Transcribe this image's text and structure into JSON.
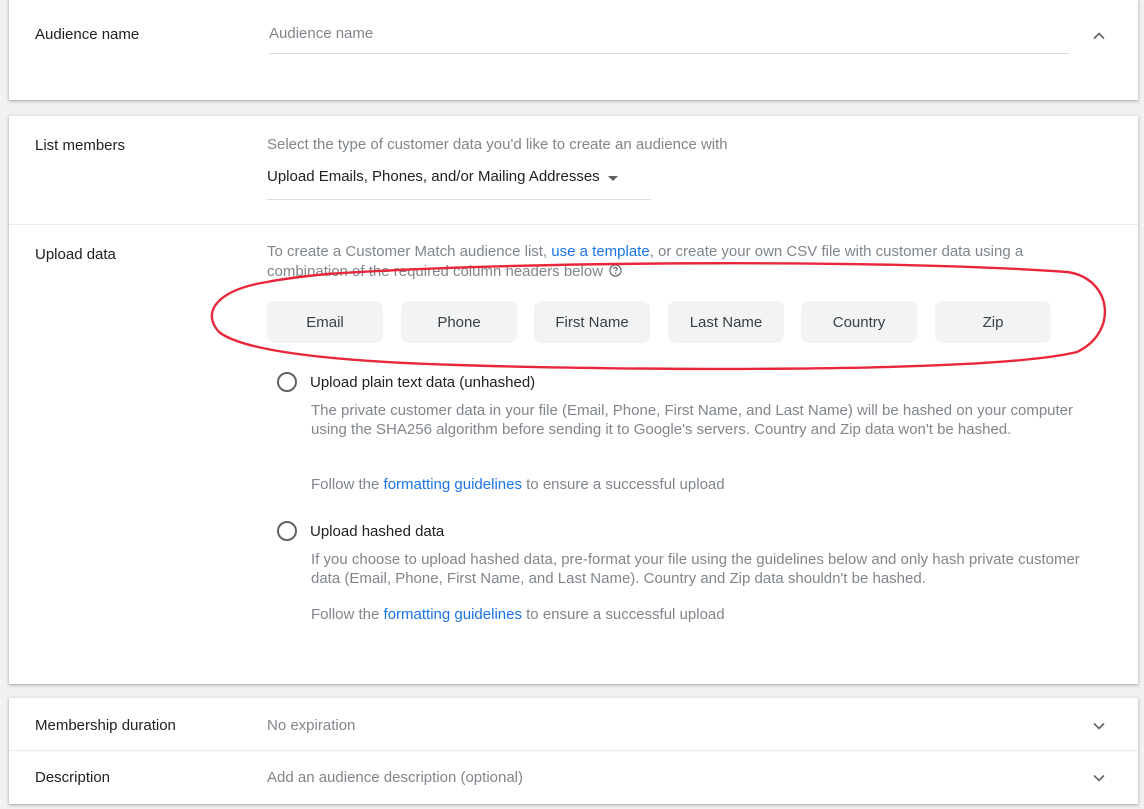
{
  "audience_name": {
    "label": "Audience name",
    "placeholder": "Audience name"
  },
  "list_members": {
    "label": "List members",
    "hint": "Select the type of customer data you'd like to create an audience with",
    "selected": "Upload Emails, Phones, and/or Mailing Addresses"
  },
  "upload_data": {
    "label": "Upload data",
    "intro_before": "To create a Customer Match audience list, ",
    "template_link": "use a template",
    "intro_after": ", or create your own CSV file with customer data using a combination of the required column headers below",
    "column_headers": [
      "Email",
      "Phone",
      "First Name",
      "Last Name",
      "Country",
      "Zip"
    ],
    "options": [
      {
        "label": "Upload plain text data (unhashed)",
        "description": "The private customer data in your file (Email, Phone, First Name, and Last Name) will be hashed on your computer using the SHA256 algorithm before sending it to Google's servers. Country and Zip data won't be hashed.",
        "follow_before": "Follow the ",
        "follow_link": "formatting guidelines",
        "follow_after": " to ensure a successful upload"
      },
      {
        "label": "Upload hashed data",
        "description": "If you choose to upload hashed data, pre-format your file using the guidelines below and only hash private customer data (Email, Phone, First Name, and Last Name). Country and Zip data shouldn't be hashed.",
        "follow_before": "Follow the ",
        "follow_link": "formatting guidelines",
        "follow_after": " to ensure a successful upload"
      }
    ]
  },
  "membership_duration": {
    "label": "Membership duration",
    "value": "No expiration"
  },
  "description": {
    "label": "Description",
    "value": "Add an audience description (optional)"
  },
  "colors": {
    "link": "#1a73e8",
    "annotation": "#e8283a",
    "chip_bg": "#f1f3f4"
  },
  "icons": {
    "collapse": "chevron-up-icon",
    "expand": "chevron-down-icon",
    "help": "help-icon",
    "dropdown": "caret-down-icon"
  }
}
